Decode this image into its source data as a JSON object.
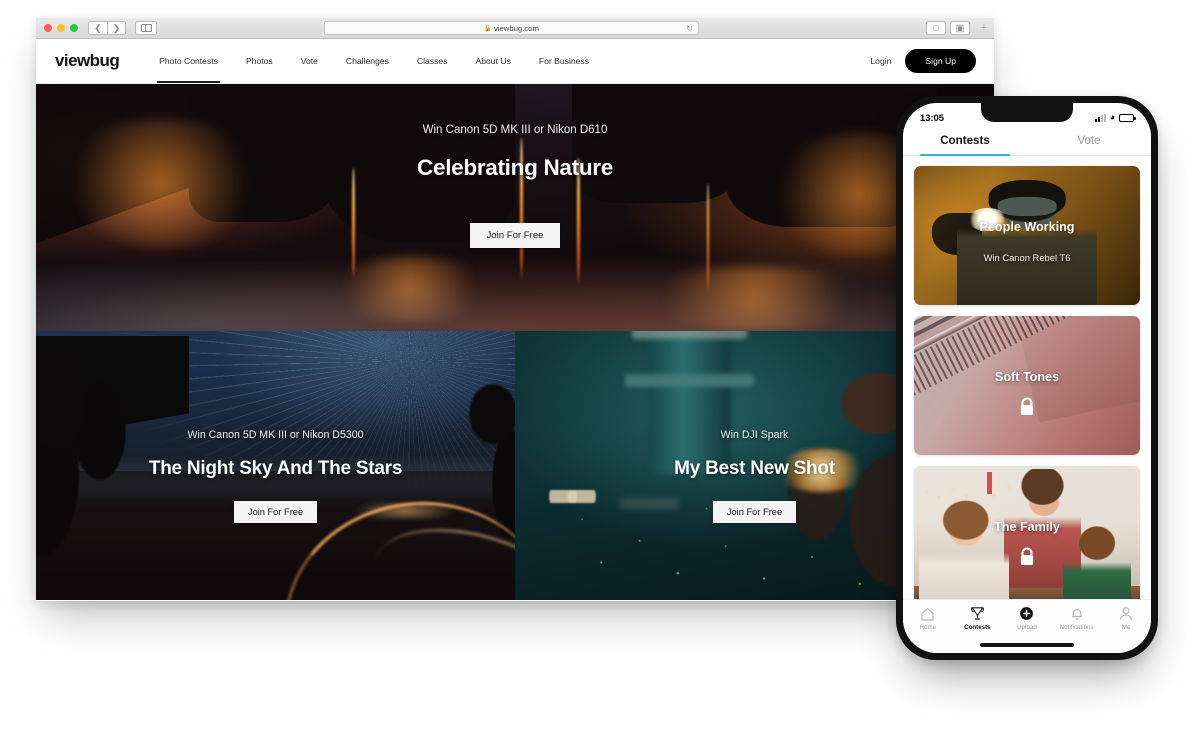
{
  "browser": {
    "url": "viewbug.com",
    "lock_icon": "lock-icon",
    "reload_icon": "reload-icon",
    "back_icon": "chevron-left-icon",
    "forward_icon": "chevron-right-icon",
    "sidebar_icon": "sidebar-toggle-icon",
    "share_icon": "share-icon",
    "tabs_icon": "tab-overview-icon",
    "new_tab_icon": "plus-icon"
  },
  "site": {
    "logo": "viewbug",
    "nav": [
      {
        "label": "Photo Contests",
        "active": true
      },
      {
        "label": "Photos",
        "active": false
      },
      {
        "label": "Vote",
        "active": false
      },
      {
        "label": "Challenges",
        "active": false
      },
      {
        "label": "Classes",
        "active": false
      },
      {
        "label": "About Us",
        "active": false
      },
      {
        "label": "For Business",
        "active": false
      }
    ],
    "login_label": "Login",
    "signup_label": "Sign Up"
  },
  "heroes": {
    "primary": {
      "prize": "Win Canon 5D MK III or Nikon D610",
      "title": "Celebrating Nature",
      "cta": "Join For Free"
    },
    "left": {
      "prize": "Win Canon 5D MK III or Nikon D5300",
      "title": "The Night Sky And The Stars",
      "cta": "Join For Free"
    },
    "right": {
      "prize": "Win DJI Spark",
      "title": "My Best New Shot",
      "cta": "Join For Free"
    }
  },
  "phone": {
    "status": {
      "time": "13:05",
      "cell_icon": "cellular-signal-icon",
      "wifi_icon": "wifi-icon",
      "battery_icon": "battery-icon"
    },
    "tabs": [
      {
        "label": "Contests",
        "active": true
      },
      {
        "label": "Vote",
        "active": false
      }
    ],
    "accent": "#2db2f0",
    "cards": [
      {
        "title": "People Working",
        "subtitle": "Win Canon Rebel T6",
        "locked": false
      },
      {
        "title": "Soft Tones",
        "subtitle": "",
        "locked": true
      },
      {
        "title": "The Family",
        "subtitle": "",
        "locked": true
      }
    ],
    "tabbar": [
      {
        "label": "Home",
        "icon": "home-icon",
        "active": false
      },
      {
        "label": "Contests",
        "icon": "trophy-icon",
        "active": true
      },
      {
        "label": "Upload",
        "icon": "plus-circle-icon",
        "active": false
      },
      {
        "label": "Notifications",
        "icon": "bell-icon",
        "active": false
      },
      {
        "label": "Me",
        "icon": "person-icon",
        "active": false
      }
    ],
    "lock_icon": "lock-icon"
  }
}
